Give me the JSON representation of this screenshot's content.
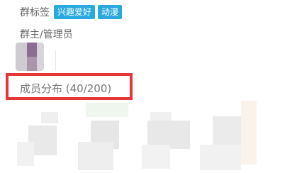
{
  "group": {
    "tags_label": "群标签",
    "tags": [
      "兴趣爱好",
      "动漫"
    ],
    "admin_label": "群主/管理员",
    "member_label": "成员分布 (40/200)"
  },
  "colors": {
    "tag_bg": "#2aa9e0",
    "highlight_border": "#e7363a"
  }
}
